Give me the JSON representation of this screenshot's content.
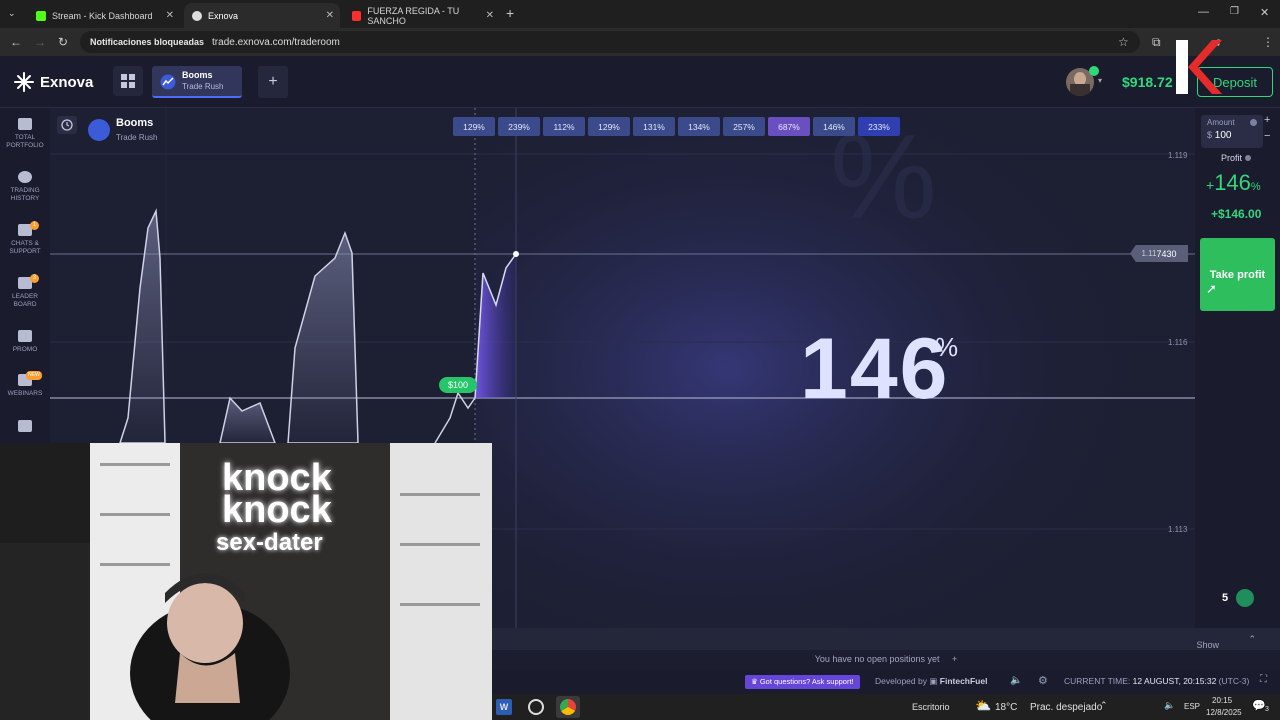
{
  "browser": {
    "tabs": [
      {
        "label": "Stream - Kick Dashboard",
        "color": "#53fc18"
      },
      {
        "label": "Exnova",
        "color": "#cccccc"
      },
      {
        "label": "FUERZA REGIDA - TU SANCHO",
        "color": "#ff2d2d"
      }
    ],
    "blocked_notice": "Notificaciones bloqueadas",
    "url": "trade.exnova.com/traderoom"
  },
  "app": {
    "logo": "Exnova",
    "asset_tab": {
      "name": "Booms",
      "mode": "Trade Rush"
    },
    "balance": "$918.72",
    "deposit_label": "Deposit"
  },
  "nav": [
    {
      "label": "TOTAL\nPORTFOLIO"
    },
    {
      "label": "TRADING\nHISTORY"
    },
    {
      "label": "CHATS &\nSUPPORT",
      "badge": "1"
    },
    {
      "label": "LEADER\nBOARD",
      "badge": "3"
    },
    {
      "label": "PROMO"
    },
    {
      "label": "WEBINARS",
      "badge": "NEW"
    }
  ],
  "chart": {
    "asset_name": "Booms",
    "asset_mode": "Trade Rush",
    "multipliers": [
      "129%",
      "239%",
      "112%",
      "129%",
      "131%",
      "134%",
      "257%",
      "687%",
      "146%",
      "233%"
    ],
    "price_ticks": [
      "1.119",
      "1.116",
      "1.113"
    ],
    "current_price_prefix": "1.11",
    "current_price_suffix": "7430",
    "big_percent": "146",
    "big_percent_sign": "%",
    "entry_tag": "$100"
  },
  "trade": {
    "amount_label": "Amount",
    "amount_currency": "$",
    "amount_value": "100",
    "profit_label": "Profit",
    "profit_pct_sign": "+",
    "profit_pct": "146",
    "profit_pct_unit": "%",
    "profit_amount": "+$146.00",
    "take_profit_label": "Take profit",
    "viewers": "5"
  },
  "bottom": {
    "show_positions": "Show positions",
    "no_positions": "You have no open positions yet",
    "support": "Got questions? Ask support!",
    "developed_by": "Developed by",
    "developer": "FintechFuel",
    "current_time_label": "CURRENT TIME:",
    "current_time_value": "12 AUGUST, 20:15:32",
    "timezone": "(UTC-3)"
  },
  "taskbar": {
    "desktop": "Escritorio",
    "weather_temp": "18°C",
    "weather_text": "Prac. despejado",
    "lang": "ESP",
    "time": "20:15",
    "date": "12/8/2025",
    "notif_count": "3"
  },
  "webcam": {
    "neon_line1": "knock",
    "neon_line2": "knock",
    "neon_line3": "sex-dater"
  }
}
